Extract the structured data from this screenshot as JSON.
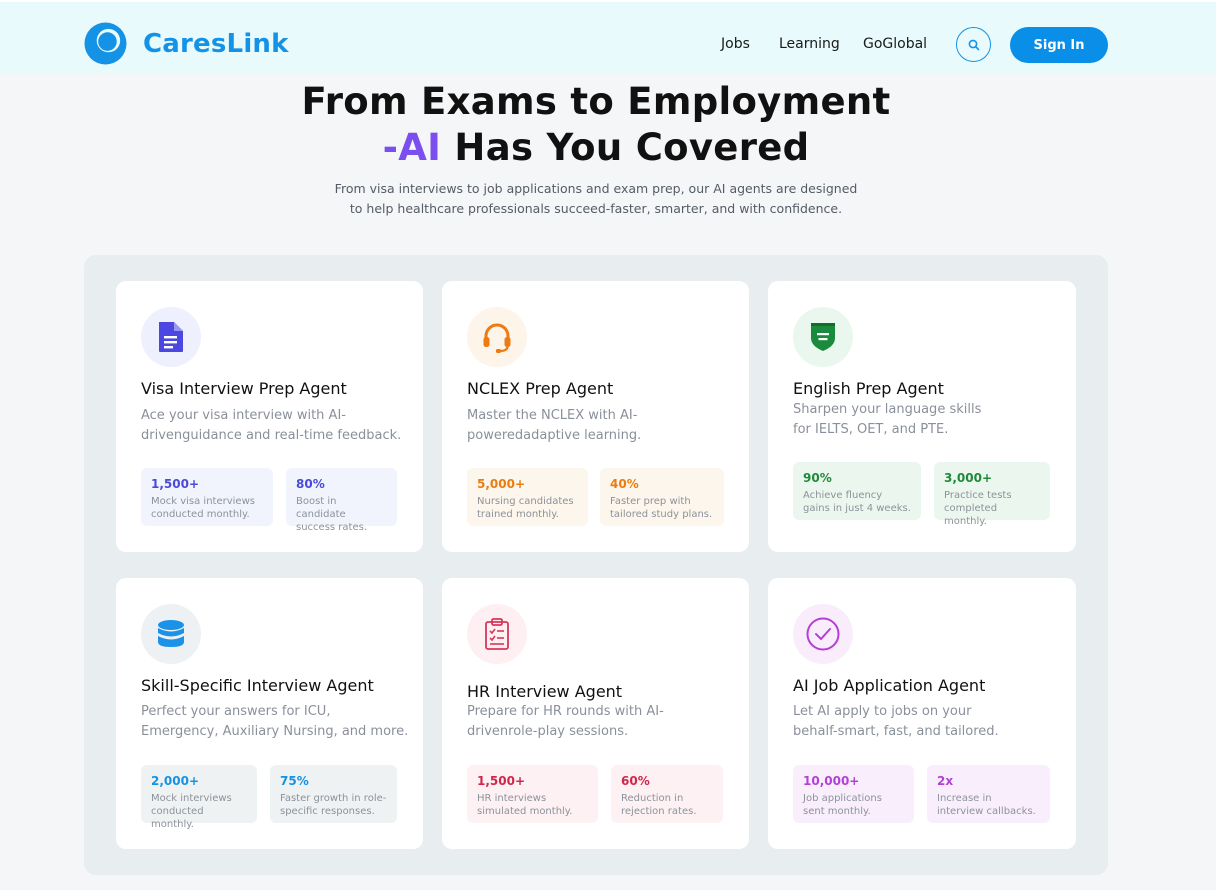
{
  "header": {
    "brand": "CaresLink",
    "nav": [
      "Jobs",
      "Learning",
      "GoGlobal"
    ],
    "search_icon": "search-icon",
    "signin_label": "Sign In",
    "brand_color": "#1492e6"
  },
  "hero": {
    "title_line1": "From Exams to Employment",
    "title_accent": "-AI",
    "title_line2_rest": " Has You Covered",
    "subtitle_line1": "From visa interviews to job applications and exam prep, our AI agents are designed",
    "subtitle_line2": "to help healthcare professionals succeed-faster, smarter, and with confidence.",
    "accent_color": "#7b4ef0"
  },
  "cards": [
    {
      "icon": "document-icon",
      "title": "Visa Interview Prep Agent",
      "desc": [
        "Ace your visa interview with AI-",
        "drivenguidance and real-time feedback."
      ],
      "stats": [
        {
          "value": "1,500+",
          "label": [
            "Mock visa interviews",
            "conducted monthly."
          ]
        },
        {
          "value": "80%",
          "label": [
            "Boost in candidate",
            "success rates."
          ]
        }
      ],
      "accent": "#4a4ad8"
    },
    {
      "icon": "headset-icon",
      "title": "NCLEX Prep Agent",
      "desc": [
        "Master the NCLEX with AI-",
        "poweredadaptive learning."
      ],
      "stats": [
        {
          "value": "5,000+",
          "label": [
            "Nursing candidates",
            "trained monthly."
          ]
        },
        {
          "value": "40%",
          "label": [
            "Faster prep with",
            "tailored study plans."
          ]
        }
      ],
      "accent": "#ea7d12"
    },
    {
      "icon": "shield-badge-icon",
      "title": "English Prep Agent",
      "desc": [
        "Sharpen your language skills",
        "for IELTS, OET, and PTE."
      ],
      "stats": [
        {
          "value": "90%",
          "label": [
            "Achieve fluency",
            "gains in just 4 weeks."
          ]
        },
        {
          "value": "3,000+",
          "label": [
            "Practice tests",
            "completed monthly."
          ]
        }
      ],
      "accent": "#1f8a3b"
    },
    {
      "icon": "database-icon",
      "title": "Skill-Specific Interview Agent",
      "desc": [
        "Perfect your answers for ICU,",
        "Emergency, Auxiliary Nursing, and more."
      ],
      "stats": [
        {
          "value": "2,000+",
          "label": [
            "Mock interviews",
            "conducted monthly."
          ]
        },
        {
          "value": "75%",
          "label": [
            "Faster growth in role-",
            "specific responses."
          ]
        }
      ],
      "accent": "#1492e6"
    },
    {
      "icon": "clipboard-icon",
      "title": "HR Interview Agent",
      "desc": [
        "Prepare for HR rounds with AI-",
        "drivenrole-play sessions."
      ],
      "stats": [
        {
          "value": "1,500+",
          "label": [
            "HR interviews",
            "simulated monthly."
          ]
        },
        {
          "value": "60%",
          "label": [
            "Reduction in",
            "rejection rates."
          ]
        }
      ],
      "accent": "#d0264c"
    },
    {
      "icon": "check-circle-icon",
      "title": "AI Job Application Agent",
      "desc": [
        "Let AI apply to jobs on your",
        "behalf-smart, fast, and tailored."
      ],
      "stats": [
        {
          "value": "10,000+",
          "label": [
            "Job applications",
            "sent monthly."
          ]
        },
        {
          "value": "2x",
          "label": [
            "Increase in",
            "interview callbacks."
          ]
        }
      ],
      "accent": "#b43fd6"
    }
  ]
}
